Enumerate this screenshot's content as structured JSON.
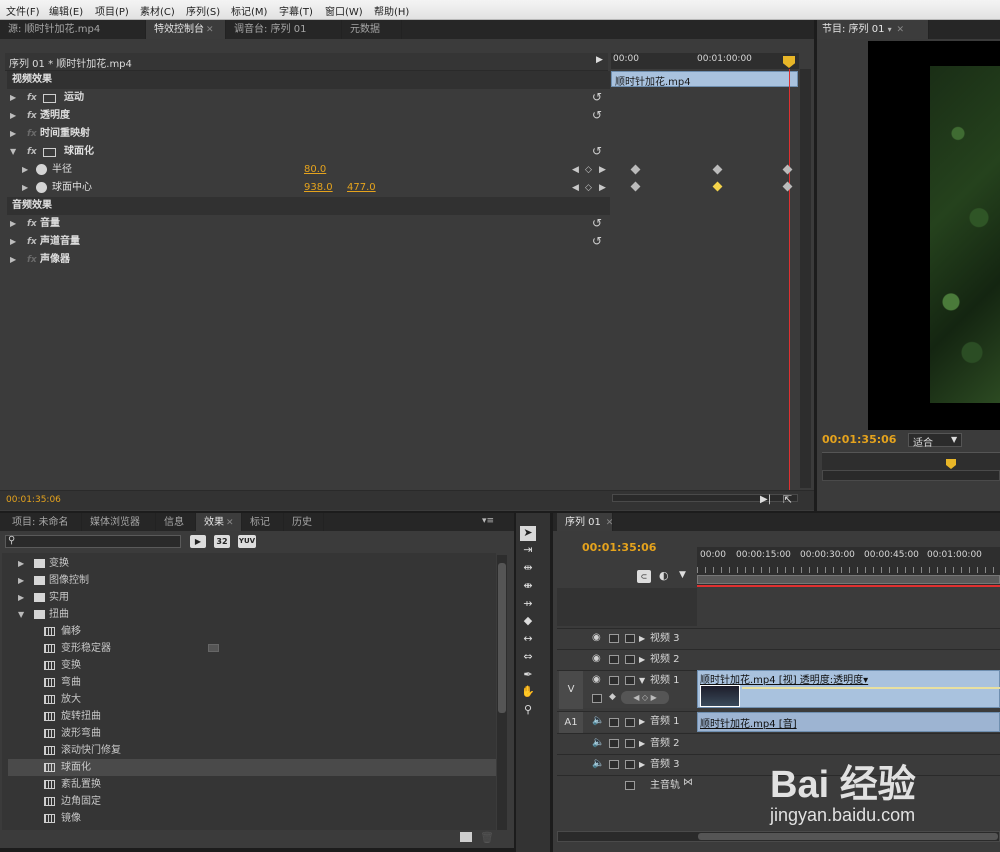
{
  "menubar": {
    "items": [
      "文件(F)",
      "编辑(E)",
      "项目(P)",
      "素材(C)",
      "序列(S)",
      "标记(M)",
      "字幕(T)",
      "窗口(W)",
      "帮助(H)"
    ]
  },
  "top_tabs": {
    "source": "源: 顺时针加花.mp4",
    "effect_controls": "特效控制台",
    "audio_mixer": "调音台: 序列 01",
    "metadata": "元数据",
    "program": "节目: 序列 01"
  },
  "effect_controls": {
    "clip_path": "序列 01 * 顺时针加花.mp4",
    "ruler": [
      "00:00",
      "00:01:00:00"
    ],
    "clip_bar": "顺时针加花.mp4",
    "video_section": "视频效果",
    "audio_section": "音频效果",
    "effects": [
      {
        "label": "运动"
      },
      {
        "label": "透明度"
      },
      {
        "label": "时间重映射"
      },
      {
        "label": "球面化"
      }
    ],
    "params": [
      {
        "label": "半径",
        "v1": "80.0",
        "v2": ""
      },
      {
        "label": "球面中心",
        "v1": "938.0",
        "v2": "477.0"
      }
    ],
    "audio_effects": [
      {
        "label": "音量"
      },
      {
        "label": "声道音量"
      },
      {
        "label": "声像器"
      }
    ],
    "current_time": "00:01:35:06"
  },
  "program": {
    "timecode": "00:01:35:06",
    "fit_label": "适合"
  },
  "bottom_tabs": {
    "project": "项目: 未命名",
    "media_browser": "媒体浏览器",
    "info": "信息",
    "effects": "效果",
    "markers": "标记",
    "history": "历史",
    "sequence": "序列 01"
  },
  "effects_panel": {
    "search_placeholder": "",
    "badge_32": "32",
    "badge_yuv": "YUV",
    "items": [
      {
        "label": "变换",
        "type": "folder",
        "level": 0
      },
      {
        "label": "图像控制",
        "type": "folder",
        "level": 0
      },
      {
        "label": "实用",
        "type": "folder",
        "level": 0
      },
      {
        "label": "扭曲",
        "type": "folder",
        "level": 0,
        "open": true
      },
      {
        "label": "偏移",
        "type": "effect",
        "level": 1
      },
      {
        "label": "变形稳定器",
        "type": "effect",
        "level": 1
      },
      {
        "label": "变换",
        "type": "effect",
        "level": 1
      },
      {
        "label": "弯曲",
        "type": "effect",
        "level": 1
      },
      {
        "label": "放大",
        "type": "effect",
        "level": 1
      },
      {
        "label": "旋转扭曲",
        "type": "effect",
        "level": 1
      },
      {
        "label": "波形弯曲",
        "type": "effect",
        "level": 1
      },
      {
        "label": "滚动快门修复",
        "type": "effect",
        "level": 1
      },
      {
        "label": "球面化",
        "type": "effect",
        "level": 1,
        "selected": true
      },
      {
        "label": "紊乱置换",
        "type": "effect",
        "level": 1
      },
      {
        "label": "边角固定",
        "type": "effect",
        "level": 1
      },
      {
        "label": "镜像",
        "type": "effect",
        "level": 1
      }
    ]
  },
  "timeline": {
    "timecode": "00:01:35:06",
    "ruler": [
      "00:00",
      "00:00:15:00",
      "00:00:30:00",
      "00:00:45:00",
      "00:01:00:00"
    ],
    "tracks": {
      "v3": "视频 3",
      "v2": "视频 2",
      "v1": "视频 1",
      "a1": "音频 1",
      "a2": "音频 2",
      "a3": "音频 3",
      "master": "主音轨"
    },
    "v_label": "V",
    "a_label": "A1",
    "video_clip": "顺时针加花.mp4 [视] 透明度:透明度▾",
    "audio_clip": "顺时针加花.mp4 [音]"
  },
  "watermark": {
    "brand": "Bai 经验",
    "url": "jingyan.baidu.com"
  },
  "colors": {
    "accent": "#e5a31d",
    "playhead": "#e03030",
    "clip_blue": "#a9c2de"
  }
}
